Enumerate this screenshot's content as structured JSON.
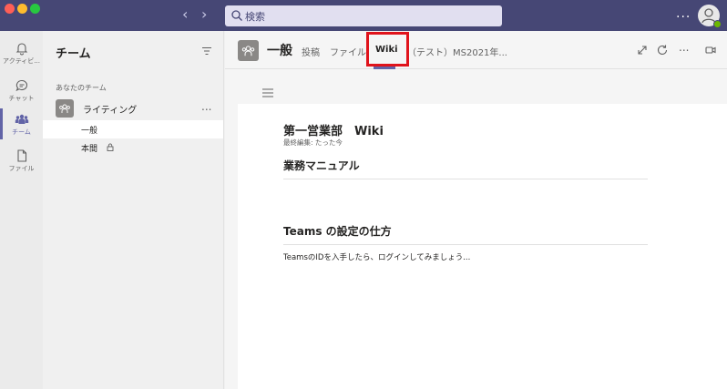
{
  "search": {
    "placeholder": "検索"
  },
  "rail": {
    "items": [
      {
        "label": "アクティビ..."
      },
      {
        "label": "チャット"
      },
      {
        "label": "チーム"
      },
      {
        "label": "ファイル"
      }
    ]
  },
  "teams_pane": {
    "title": "チーム",
    "section_label": "あなたのチーム",
    "team": {
      "name": "ライティング",
      "more": "..."
    },
    "channels": [
      {
        "name": "一般",
        "selected": true
      },
      {
        "name": "本間",
        "private": true
      }
    ]
  },
  "channel": {
    "title": "一般",
    "tabs": [
      {
        "label": "投稿"
      },
      {
        "label": "ファイル"
      },
      {
        "label": "Wiki",
        "active": true
      },
      {
        "label": "（テスト）MS2021年..."
      }
    ],
    "more": "...",
    "top_more": "..."
  },
  "wiki": {
    "title": "第一営業部　Wiki",
    "meta": "最終編集: たった今",
    "sections": [
      {
        "heading": "業務マニュアル",
        "body": ""
      },
      {
        "heading": "Teams の設定の仕方",
        "body": "TeamsのIDを入手したら、ログインしてみましょう..."
      }
    ]
  },
  "colors": {
    "titlebar": "#464775",
    "accent": "#6264a7",
    "highlight": "#e0131b"
  }
}
